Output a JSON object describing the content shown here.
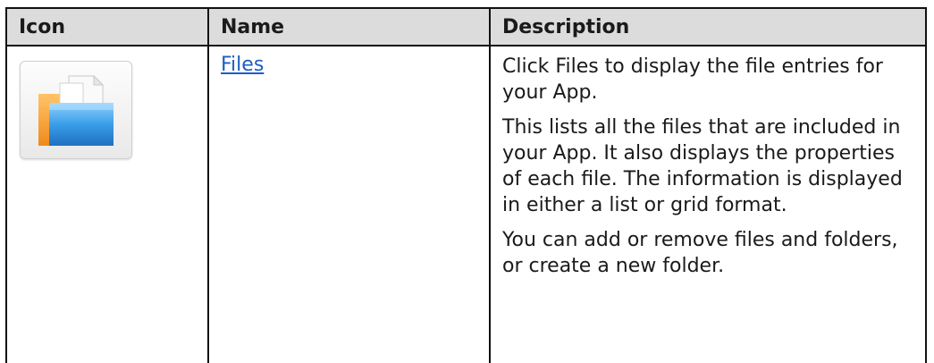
{
  "table": {
    "headers": {
      "icon": "Icon",
      "name": "Name",
      "description": "Description"
    },
    "rows": [
      {
        "icon": "folder-files-icon",
        "name": "Files",
        "description": [
          "Click Files to display the file entries for your App.",
          "This lists all the files that are included in your App. It also displays the properties of each file. The information is displayed in either a list or grid format.",
          "You can add or remove files and folders, or create a new folder."
        ]
      }
    ]
  },
  "colors": {
    "header_background": "#dcdcdc",
    "border": "#111111",
    "link": "#1b5dc4",
    "folder_blue": "#3a9ee8",
    "folder_orange": "#f39a2b"
  }
}
